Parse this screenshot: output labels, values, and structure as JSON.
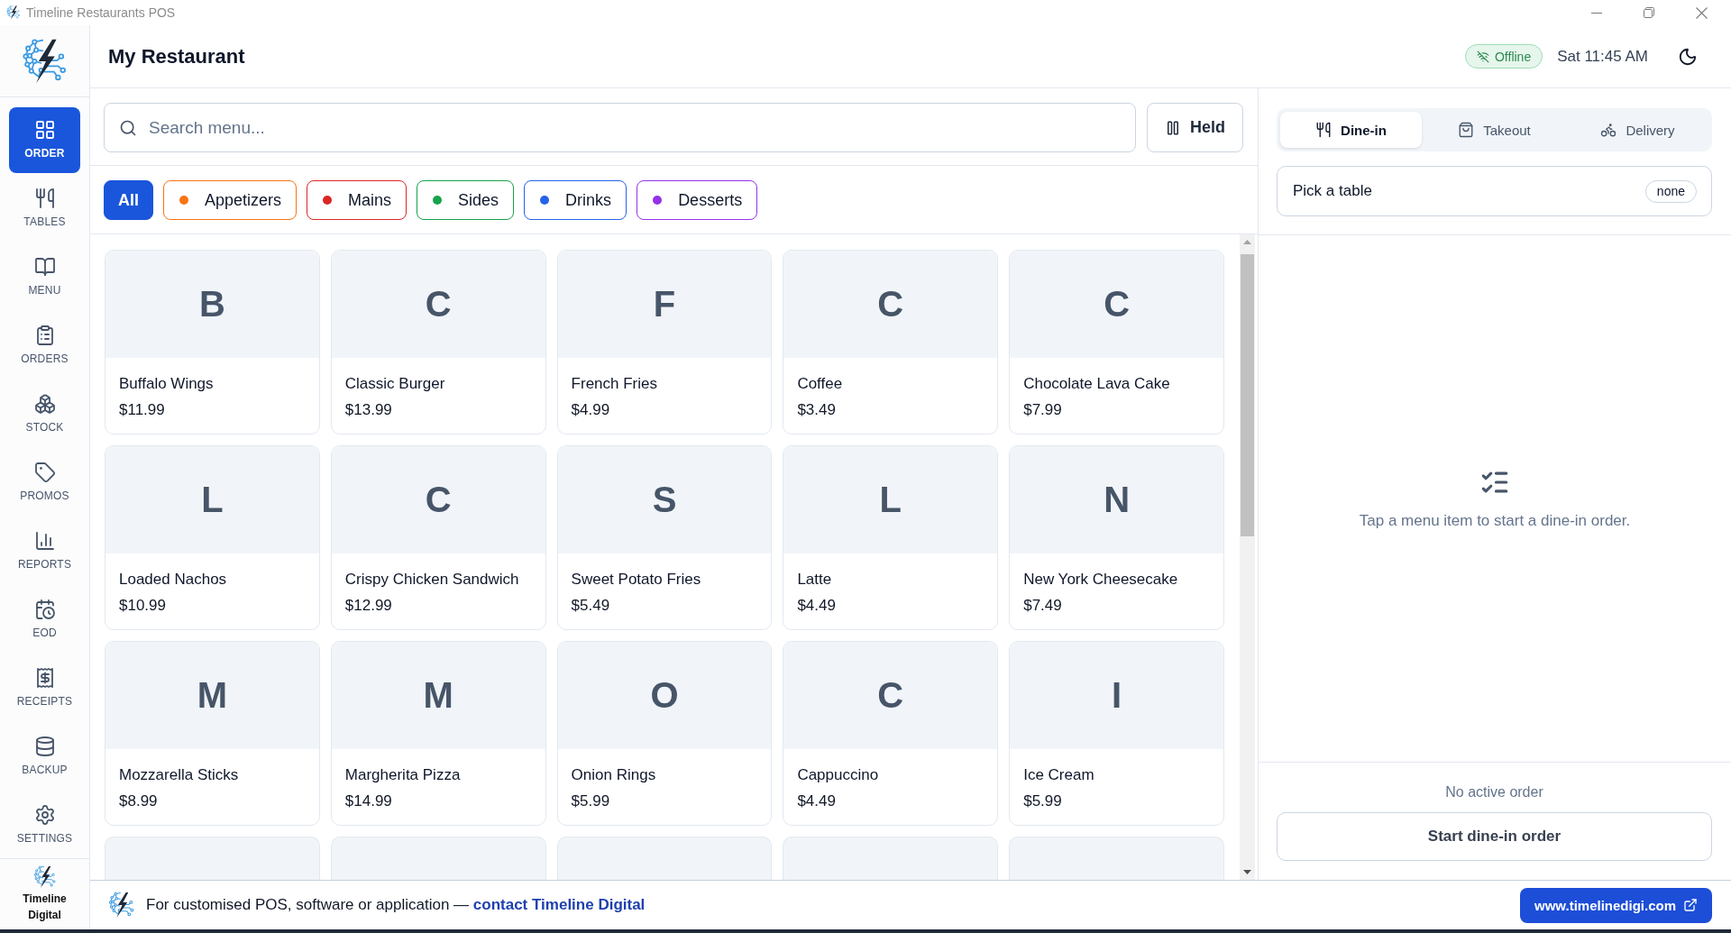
{
  "window": {
    "title": "Timeline Restaurants POS"
  },
  "sidebar": {
    "items": [
      {
        "label": "ORDER",
        "selected": true
      },
      {
        "label": "TABLES",
        "selected": false
      },
      {
        "label": "MENU",
        "selected": false
      },
      {
        "label": "ORDERS",
        "selected": false
      },
      {
        "label": "STOCK",
        "selected": false
      },
      {
        "label": "PROMOS",
        "selected": false
      },
      {
        "label": "REPORTS",
        "selected": false
      },
      {
        "label": "EOD",
        "selected": false
      },
      {
        "label": "RECEIPTS",
        "selected": false
      },
      {
        "label": "BACKUP",
        "selected": false
      },
      {
        "label": "SETTINGS",
        "selected": false
      }
    ],
    "brand": "Timeline Digital"
  },
  "header": {
    "title": "My Restaurant",
    "status": "Offline",
    "clock": "Sat 11:45 AM"
  },
  "search": {
    "placeholder": "Search menu..."
  },
  "held_button": "Held",
  "categories": [
    {
      "label": "All",
      "selected": true
    },
    {
      "label": "Appetizers",
      "selected": false,
      "color": "#f97316"
    },
    {
      "label": "Mains",
      "selected": false,
      "color": "#dc2626"
    },
    {
      "label": "Sides",
      "selected": false,
      "color": "#16a34a"
    },
    {
      "label": "Drinks",
      "selected": false,
      "color": "#2563eb"
    },
    {
      "label": "Desserts",
      "selected": false,
      "color": "#9333ea"
    }
  ],
  "menu_items": [
    {
      "letter": "B",
      "name": "Buffalo Wings",
      "price": "$11.99"
    },
    {
      "letter": "C",
      "name": "Classic Burger",
      "price": "$13.99"
    },
    {
      "letter": "F",
      "name": "French Fries",
      "price": "$4.99"
    },
    {
      "letter": "C",
      "name": "Coffee",
      "price": "$3.49"
    },
    {
      "letter": "C",
      "name": "Chocolate Lava Cake",
      "price": "$7.99"
    },
    {
      "letter": "L",
      "name": "Loaded Nachos",
      "price": "$10.99"
    },
    {
      "letter": "C",
      "name": "Crispy Chicken Sandwich",
      "price": "$12.99"
    },
    {
      "letter": "S",
      "name": "Sweet Potato Fries",
      "price": "$5.49"
    },
    {
      "letter": "L",
      "name": "Latte",
      "price": "$4.49"
    },
    {
      "letter": "N",
      "name": "New York Cheesecake",
      "price": "$7.49"
    },
    {
      "letter": "M",
      "name": "Mozzarella Sticks",
      "price": "$8.99"
    },
    {
      "letter": "M",
      "name": "Margherita Pizza",
      "price": "$14.99"
    },
    {
      "letter": "O",
      "name": "Onion Rings",
      "price": "$5.99"
    },
    {
      "letter": "C",
      "name": "Cappuccino",
      "price": "$4.49"
    },
    {
      "letter": "I",
      "name": "Ice Cream",
      "price": "$5.99"
    }
  ],
  "partly_visible_cards": [
    {
      "cut_off": true
    },
    {
      "cut_off": true
    },
    {
      "cut_off": true
    },
    {
      "cut_off": true
    },
    {
      "cut_off": true
    }
  ],
  "order_panel": {
    "tabs": [
      {
        "label": "Dine-in",
        "selected": true
      },
      {
        "label": "Takeout",
        "selected": false
      },
      {
        "label": "Delivery",
        "selected": false
      }
    ],
    "table_picker": {
      "label": "Pick a table",
      "value": "none"
    },
    "empty_message": "Tap a menu item to start a dine-in order.",
    "status": "No active order",
    "start_button": "Start dine-in order"
  },
  "footer": {
    "text": "For customised POS, software or application —",
    "link": "contact Timeline Digital",
    "website_button": "www.timelinedigi.com"
  }
}
